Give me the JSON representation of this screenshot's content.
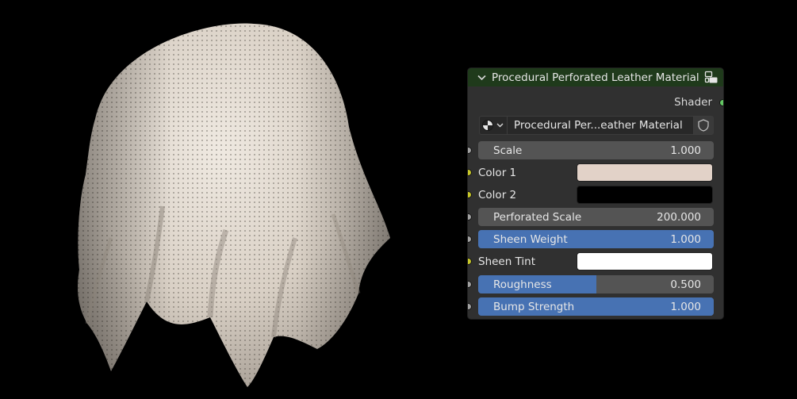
{
  "node": {
    "title": "Procedural Perforated Leather Material",
    "output_label": "Shader",
    "material_name": "Procedural Per...eather Material",
    "icons": {
      "collapse": "chevron-down-icon",
      "group": "node-group-icon",
      "material": "material-sphere-icon",
      "dropdown": "chevron-down-icon",
      "fake_user": "shield-icon"
    },
    "header_color": "#1f3a1b",
    "accent_color": "#4772b3",
    "inputs": [
      {
        "label": "Scale",
        "type": "value",
        "value": "1.000",
        "fill": 0
      },
      {
        "label": "Color 1",
        "type": "color",
        "color": "#e2d2c8"
      },
      {
        "label": "Color 2",
        "type": "color",
        "color": "#000000"
      },
      {
        "label": "Perforated Scale",
        "type": "value",
        "value": "200.000",
        "fill": 0
      },
      {
        "label": "Sheen Weight",
        "type": "value",
        "value": "1.000",
        "fill": 1.0
      },
      {
        "label": "Sheen Tint",
        "type": "color",
        "color": "#ffffff"
      },
      {
        "label": "Roughness",
        "type": "value",
        "value": "0.500",
        "fill": 0.5
      },
      {
        "label": "Bump Strength",
        "type": "value",
        "value": "1.000",
        "fill": 1.0
      }
    ]
  }
}
